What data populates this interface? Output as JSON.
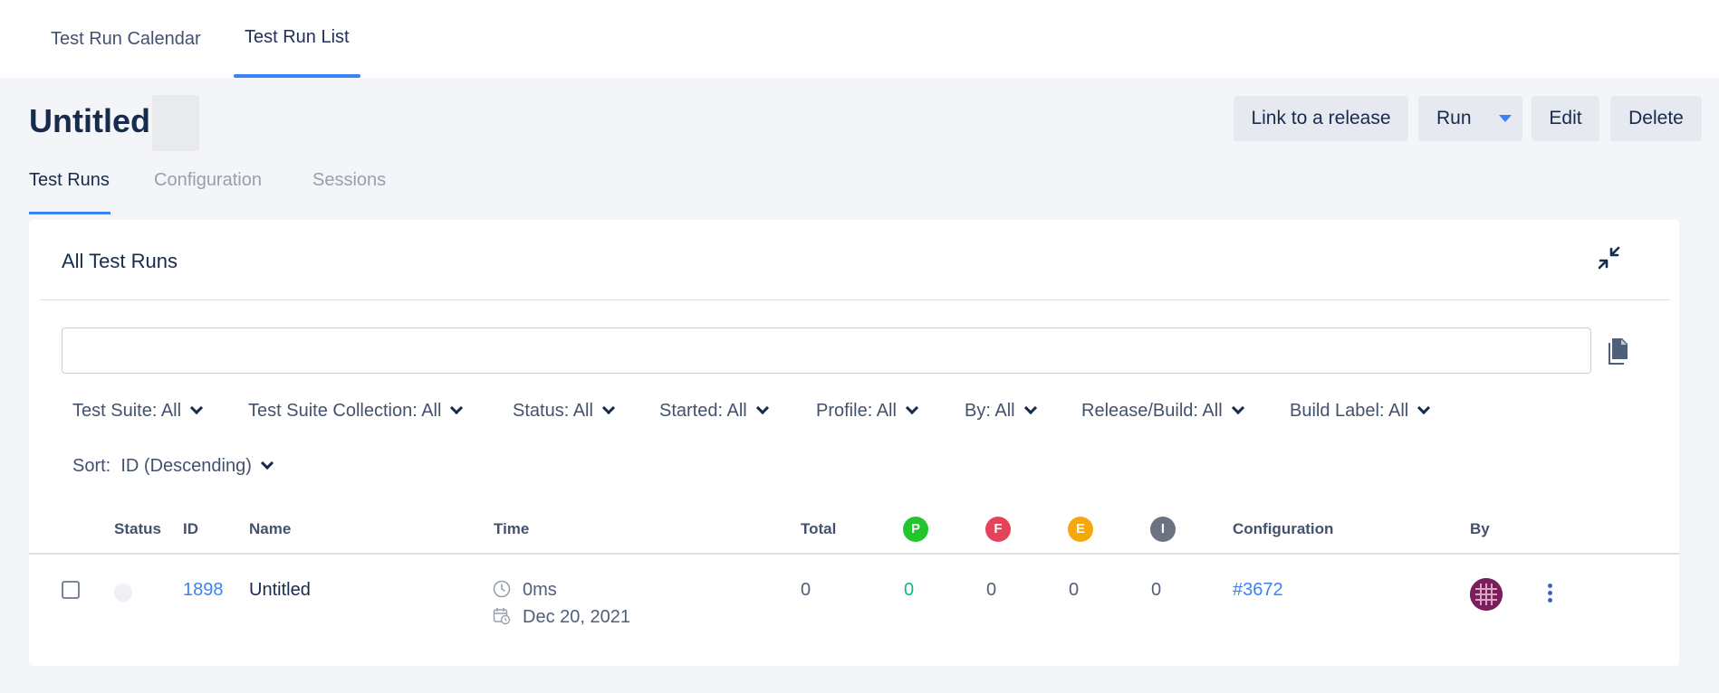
{
  "top_tabs": [
    {
      "label": "Test Run Calendar",
      "active": false
    },
    {
      "label": "Test Run List",
      "active": true
    }
  ],
  "header": {
    "title": "Untitled",
    "buttons": {
      "link_release": "Link to a release",
      "run": "Run",
      "edit": "Edit",
      "delete": "Delete"
    }
  },
  "sub_tabs": [
    {
      "label": "Test Runs",
      "active": true
    },
    {
      "label": "Configuration",
      "active": false
    },
    {
      "label": "Sessions",
      "active": false
    }
  ],
  "panel": {
    "title": "All Test Runs",
    "search": {
      "value": "",
      "placeholder": ""
    },
    "filters": [
      "Test Suite: All",
      "Test Suite Collection: All",
      "Status: All",
      "Started: All",
      "Profile: All",
      "By: All",
      "Release/Build: All",
      "Build Label: All"
    ],
    "sort": {
      "label": "Sort:",
      "value": "ID (Descending)"
    }
  },
  "table": {
    "headers": {
      "status": "Status",
      "id": "ID",
      "name": "Name",
      "time": "Time",
      "total": "Total",
      "passed": "P",
      "failed": "F",
      "error": "E",
      "incomplete": "I",
      "configuration": "Configuration",
      "by": "By"
    },
    "badge_colors": {
      "passed": "#22c52e",
      "failed": "#e5435a",
      "error": "#f5a80b",
      "incomplete": "#6b7280"
    },
    "rows": [
      {
        "id": "1898",
        "name": "Untitled",
        "duration": "0ms",
        "date": "Dec 20, 2021",
        "total": "0",
        "passed": "0",
        "failed": "0",
        "error": "0",
        "incomplete": "0",
        "configuration": "#3672"
      }
    ]
  },
  "colors": {
    "accent": "#3b82f6",
    "title": "#172b4d",
    "background": "#f4f5f8",
    "passed_text": "#10b981"
  }
}
